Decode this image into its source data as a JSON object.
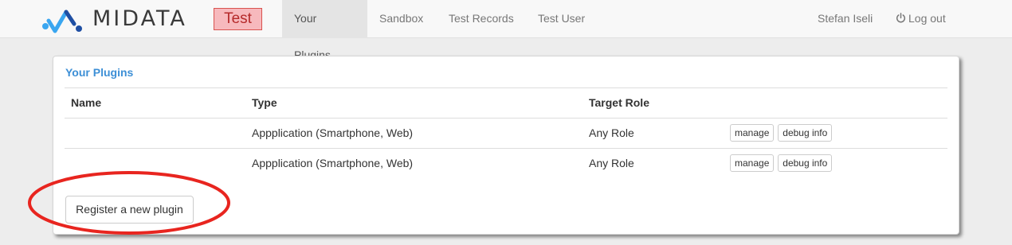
{
  "brand": {
    "name": "MIDATA",
    "environment": "Test"
  },
  "nav": {
    "items": [
      {
        "label": "Your Plugins",
        "active": true
      },
      {
        "label": "Sandbox",
        "active": false
      },
      {
        "label": "Test Records",
        "active": false
      },
      {
        "label": "Test User",
        "active": false
      }
    ],
    "username": "Stefan Iseli",
    "logout_label": "Log out"
  },
  "panel": {
    "title": "Your Plugins",
    "columns": {
      "name": "Name",
      "type": "Type",
      "role": "Target Role"
    },
    "rows": [
      {
        "name": "",
        "type": "Appplication (Smartphone, Web)",
        "role": "Any Role",
        "manage_label": "manage",
        "debug_label": "debug info"
      },
      {
        "name": "",
        "type": "Appplication (Smartphone, Web)",
        "role": "Any Role",
        "manage_label": "manage",
        "debug_label": "debug info"
      }
    ],
    "register_label": "Register a new plugin"
  },
  "colors": {
    "accent": "#3d8fd6",
    "badge_bg": "#f7b9bd",
    "annotation": "#e8251f"
  },
  "icons": {
    "logo": "midata-logo-icon",
    "logout": "power-icon"
  }
}
